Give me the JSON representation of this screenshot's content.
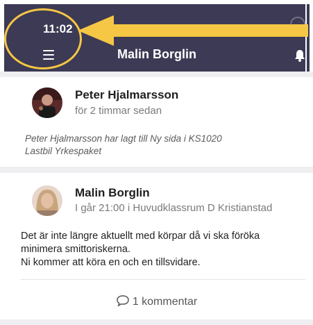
{
  "status_bar": {
    "time": "11:02"
  },
  "header": {
    "title": "Malin Borglin"
  },
  "posts": [
    {
      "author": "Peter Hjalmarsson",
      "meta": "för 2 timmar sedan",
      "activity_line1": "Peter Hjalmarsson har lagt till Ny sida i KS1020",
      "activity_line2": "Lastbil Yrkespaket"
    },
    {
      "author": "Malin Borglin",
      "meta": "I går 21:00 i Huvudklassrum D Kristianstad",
      "body_line1": "Det är inte längre aktuellt med körpar då vi ska föröka",
      "body_line2": "minimera smittoriskerna.",
      "body_line3": "Ni kommer att köra en och en tillsvidare.",
      "comments_label": "1 kommentar"
    }
  ],
  "icons": {
    "menu": "hamburger-menu-icon",
    "notifications": "bell-icon",
    "comment": "speech-bubble-icon"
  },
  "colors": {
    "header_bg": "#3d3a55",
    "annotation": "#f6c744",
    "separator": "#efeff1"
  }
}
